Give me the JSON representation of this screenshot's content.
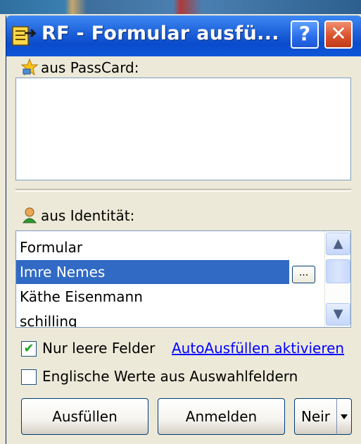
{
  "window": {
    "title": "RF - Formular ausfü...",
    "help_label": "?",
    "close_label": "✕"
  },
  "passcard": {
    "label": "aus PassCard:",
    "icon": "star-icon"
  },
  "identity": {
    "label": "aus Identität:",
    "icon": "person-icon",
    "items": [
      "Formular",
      "Imre Nemes",
      "Käthe Eisenmann",
      "schilling"
    ],
    "selected": "Imre Nemes",
    "ellipsis_label": "...",
    "scroll_up": "▲",
    "scroll_down": "▼"
  },
  "options": {
    "only_empty_fields": {
      "label": "Nur leere Felder",
      "checked": true,
      "mark": "✔"
    },
    "autofill_link": "AutoAusfüllen aktivieren",
    "english_values": {
      "label": "Englische Werte aus Auswahlfeldern",
      "checked": false
    }
  },
  "buttons": {
    "fill": "Ausfüllen",
    "login": "Anmelden",
    "new": "Neir"
  },
  "colors": {
    "titlebar": "#0a4bcc",
    "selection": "#316ac5",
    "link": "#0000ff",
    "check": "#21a121"
  }
}
